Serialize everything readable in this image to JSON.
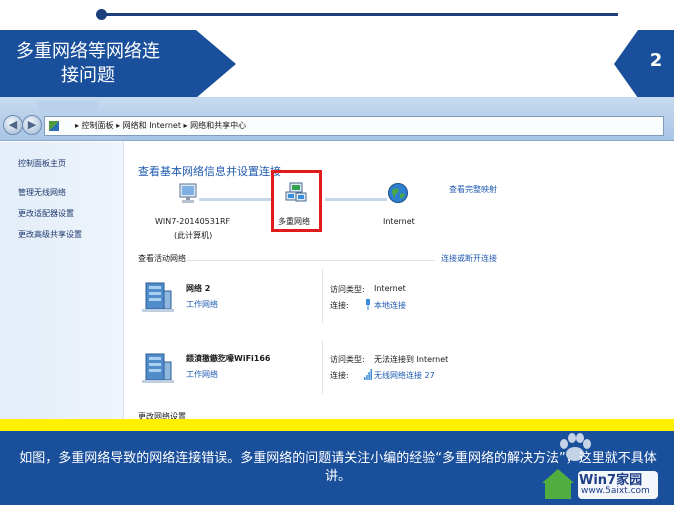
{
  "slide": {
    "title": "多重网络等网络连接问题",
    "page_number": "2",
    "caption": "如图，多重网络导致的网络连接错误。多重网络的问题请关注小编的经验“多重网络的解决方法”，这里就不具体讲。"
  },
  "window": {
    "nav_back_glyph": "◀",
    "nav_forward_glyph": "▶",
    "address_path": "▸ 控制面板 ▸ 网络和 Internet ▸ 网络和共享中心",
    "left_pane": [
      "控制面板主页",
      "管理无线网络",
      "更改适配器设置",
      "更改高级共享设置"
    ],
    "main_title": "查看基本网络信息并设置连接",
    "full_map_link": "查看完整映射",
    "nodes": {
      "computer_line1": "WIN7-20140531RF",
      "computer_line2": "(此计算机)",
      "multi_network": "多重网络",
      "internet": "Internet"
    },
    "active_networks_title": "查看活动网络",
    "connect_disconnect_link": "连接或断开连接",
    "networks": [
      {
        "name": "网络 2",
        "type": "工作网络",
        "access_type_key": "访问类型:",
        "access_type_val": "Internet",
        "connection_key": "连接:",
        "connection_val": "本地连接"
      },
      {
        "name": "鍡濆獥鏃犵嚎WiFi166",
        "type": "工作网络",
        "access_type_key": "访问类型:",
        "access_type_val": "无法连接到 Internet",
        "connection_key": "连接:",
        "connection_val": "无线网络连接 27"
      }
    ],
    "footer_cut": "更改网络设置"
  },
  "watermark": {
    "brand": "Win7家园",
    "url": "www.5aixt.com"
  },
  "colors": {
    "slide_blue": "#1a4f9c",
    "highlight_red": "#e01b1b",
    "yellow_bar": "#ffef00",
    "link_blue": "#1f5bb0"
  },
  "icons": {
    "computer": "computer-icon",
    "multi_network": "multi-network-icon",
    "internet": "globe-icon",
    "network": "network-building-icon"
  }
}
